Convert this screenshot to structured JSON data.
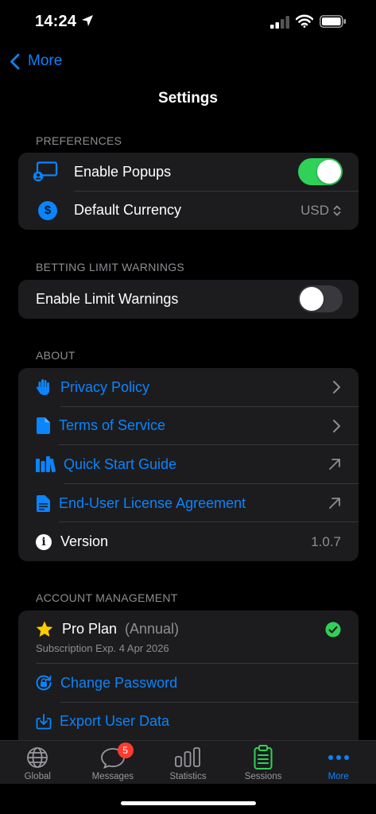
{
  "status_bar": {
    "time": "14:24"
  },
  "nav": {
    "back_label": "More",
    "title": "Settings"
  },
  "preferences": {
    "header": "PREFERENCES",
    "enable_popups_label": "Enable Popups",
    "enable_popups_on": true,
    "default_currency_label": "Default Currency",
    "default_currency_value": "USD"
  },
  "betting_limits": {
    "header": "BETTING LIMIT WARNINGS",
    "enable_limit_warnings_label": "Enable Limit Warnings",
    "enable_limit_warnings_on": false
  },
  "about": {
    "header": "ABOUT",
    "privacy_policy": "Privacy Policy",
    "terms_of_service": "Terms of Service",
    "quick_start_guide": "Quick Start Guide",
    "eula": "End-User License Agreement",
    "version_label": "Version",
    "version_value": "1.0.7"
  },
  "account": {
    "header": "ACCOUNT MANAGEMENT",
    "plan_name": "Pro Plan",
    "plan_period": "(Annual)",
    "subscription_exp": "Subscription Exp. 4 Apr 2026",
    "change_password": "Change Password",
    "export_user_data": "Export User Data"
  },
  "tab_bar": {
    "tabs": [
      {
        "label": "Global",
        "icon": "globe-icon"
      },
      {
        "label": "Messages",
        "icon": "chat-bubble-icon",
        "badge": "5"
      },
      {
        "label": "Statistics",
        "icon": "bar-chart-icon"
      },
      {
        "label": "Sessions",
        "icon": "clipboard-icon"
      },
      {
        "label": "More",
        "icon": "ellipsis-icon",
        "active": true
      }
    ]
  },
  "colors": {
    "accent": "#0a84ff",
    "toggle_on": "#30d158",
    "badge": "#ff3b30",
    "check": "#30d158",
    "star": "#ffcc00"
  }
}
